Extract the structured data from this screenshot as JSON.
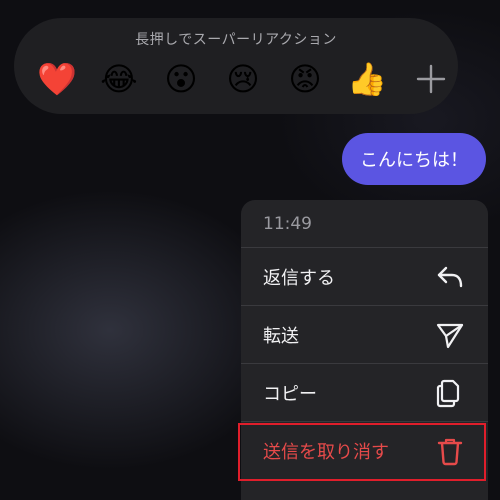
{
  "reaction_bar": {
    "hint": "長押しでスーパーリアクション",
    "emojis": [
      {
        "char": "❤️",
        "name": "red-heart"
      },
      {
        "char": "😂",
        "name": "tears-of-joy"
      },
      {
        "char": "😮",
        "name": "surprised"
      },
      {
        "char": "😢",
        "name": "crying"
      },
      {
        "char": "😡",
        "name": "angry"
      },
      {
        "char": "👍",
        "name": "thumbs-up"
      }
    ],
    "more_icon": "plus-icon"
  },
  "message": {
    "text": "こんにちは！",
    "bubble_color": "#5b55e2"
  },
  "context_menu": {
    "time": "11:49",
    "items": [
      {
        "label": "返信する",
        "icon": "reply-icon"
      },
      {
        "label": "転送",
        "icon": "send-icon"
      },
      {
        "label": "コピー",
        "icon": "copy-icon"
      },
      {
        "label": "送信を取り消す",
        "icon": "trash-icon",
        "color": "#e64a4a"
      }
    ]
  },
  "colors": {
    "danger": "#e64a4a",
    "highlight": "#e01e2b",
    "menu_bg": "#242427"
  }
}
